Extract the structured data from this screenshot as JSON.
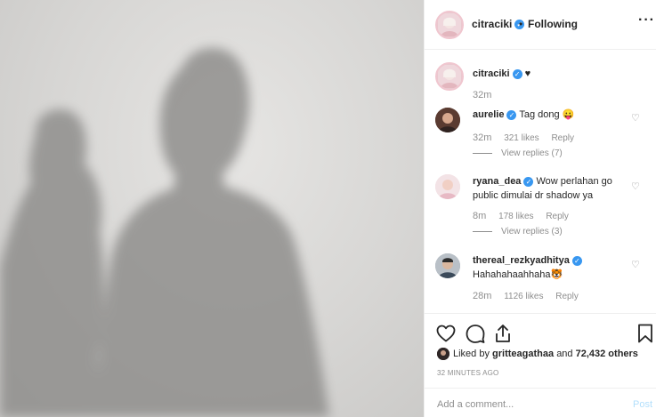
{
  "post": {
    "author": "citraciki",
    "follow_dot": "•",
    "follow_status": "Following",
    "more_glyph": "···",
    "caption": "♥",
    "caption_time": "32m"
  },
  "comments": [
    {
      "user": "aurelie",
      "text": "Tag dong 😛",
      "time": "32m",
      "likes": "321 likes",
      "reply": "Reply",
      "view_replies": "View replies (7)"
    },
    {
      "user": "ryana_dea",
      "text": "Wow perlahan go public dimulai dr shadow ya",
      "time": "8m",
      "likes": "178 likes",
      "reply": "Reply",
      "view_replies": "View replies (3)"
    },
    {
      "user": "thereal_rezkyadhitya",
      "text": "Hahahahaahhaha🐯",
      "time": "28m",
      "likes": "1126 likes",
      "reply": "Reply"
    }
  ],
  "actions": {
    "heart_icon": "heart-outline",
    "comment_icon": "speech-bubble",
    "share_icon": "share-upload",
    "save_icon": "bookmark-outline"
  },
  "likes": {
    "prefix": "Liked by",
    "user": "gritteagathaa",
    "joiner": "and",
    "others": "72,432 others"
  },
  "timestamp": "32 MINUTES AGO",
  "add_comment": {
    "placeholder": "Add a comment...",
    "post_label": "Post"
  },
  "colors": {
    "verified": "#3897f0",
    "post_disabled": "#b2dffc",
    "secondary_text": "#8e8e8e"
  }
}
